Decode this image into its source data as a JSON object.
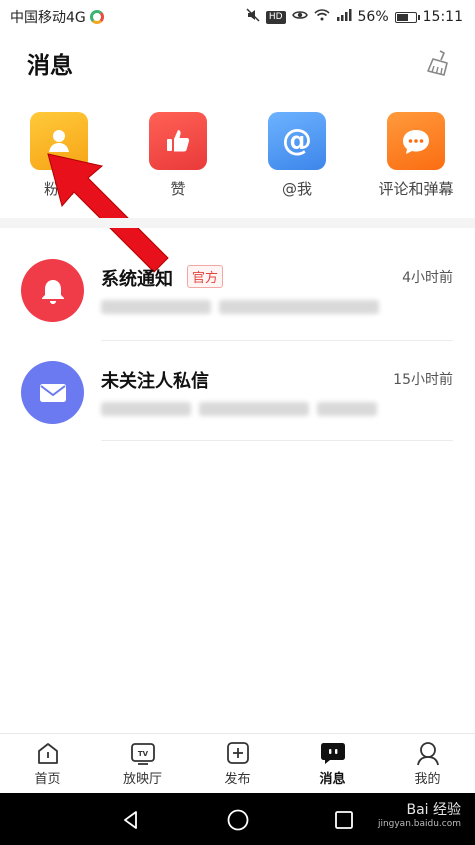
{
  "status_bar": {
    "carrier": "中国移动4G",
    "battery": "56%",
    "time": "15:11",
    "battery_level": 0.56,
    "icons": [
      "mute-icon",
      "hd-icon",
      "eye-icon",
      "wifi-icon",
      "signal-icon",
      "battery-icon"
    ]
  },
  "header": {
    "title": "消息",
    "clean_icon": "broom-icon"
  },
  "quick_entries": [
    {
      "label": "粉丝",
      "icon": "person-icon",
      "color": "#f9b624"
    },
    {
      "label": "赞",
      "icon": "thumbs-up-icon",
      "color": "#f0483e"
    },
    {
      "label": "@我",
      "icon": "at-icon",
      "color": "#4d9bf0"
    },
    {
      "label": "评论和弹幕",
      "icon": "comment-icon",
      "color": "#ff7f1e"
    }
  ],
  "messages": [
    {
      "name": "系统通知",
      "badge": "官方",
      "time": "4小时前",
      "avatar_icon": "bell-icon",
      "avatar_color": "#f03b48"
    },
    {
      "name": "未关注人私信",
      "time": "15小时前",
      "avatar_icon": "envelope-icon",
      "avatar_color": "#6b7af0"
    }
  ],
  "bottom_nav": [
    {
      "label": "首页",
      "icon": "home-icon",
      "active": false
    },
    {
      "label": "放映厅",
      "icon": "tv-icon",
      "active": false
    },
    {
      "label": "发布",
      "icon": "plus-icon",
      "active": false
    },
    {
      "label": "消息",
      "icon": "chat-icon",
      "active": true
    },
    {
      "label": "我的",
      "icon": "profile-icon",
      "active": false
    }
  ],
  "system_nav": [
    "back-icon",
    "home-circle-icon",
    "recents-icon"
  ],
  "watermark": {
    "main": "Bai 经验",
    "sub": "jingyan.baidu.com"
  },
  "colors": {
    "annotation_arrow": "#e8101a",
    "active_nav": "#111111"
  }
}
